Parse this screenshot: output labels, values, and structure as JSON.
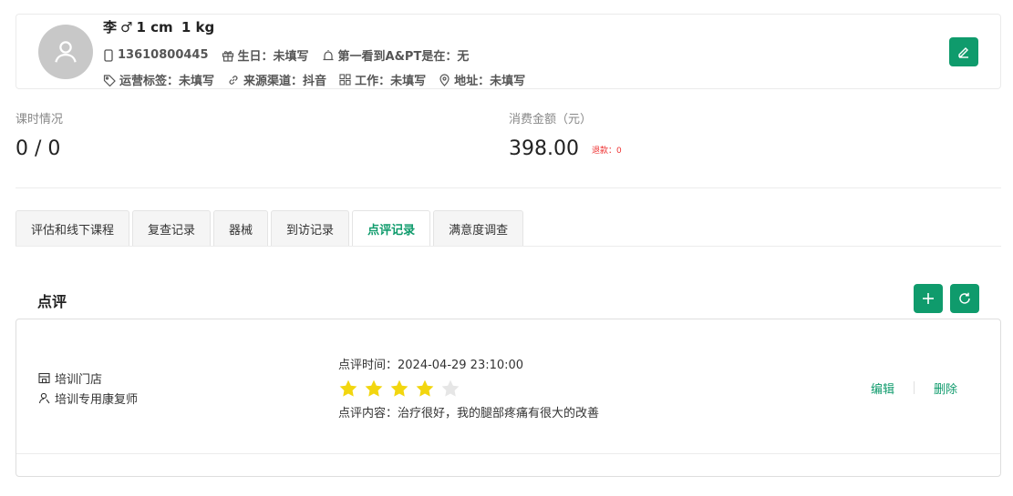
{
  "profile": {
    "name": "李",
    "gender_symbol": "♂",
    "height": "1 cm",
    "weight": "1 kg",
    "phone": "13610800445",
    "birthday_label": "生日：",
    "birthday_value": "未填写",
    "first_seen_label": "第一看到A&PT是在：",
    "first_seen_value": "无",
    "ops_tag_label": "运营标签：",
    "ops_tag_value": "未填写",
    "source_label": "来源渠道：",
    "source_value": "抖音",
    "job_label": "工作：",
    "job_value": "未填写",
    "address_label": "地址：",
    "address_value": "未填写",
    "icons": [
      "avatar-user-icon",
      "phone-icon",
      "gift-icon",
      "alarm-icon",
      "tag-icon",
      "link-icon",
      "grid-icon",
      "location-icon",
      "edit-icon"
    ]
  },
  "stats": {
    "hours_label": "课时情况",
    "hours_value": "0 / 0",
    "spend_label": "消费金额（元）",
    "spend_value": "398.00",
    "refund_text": "退款：0"
  },
  "tabs": [
    {
      "label": "评估和线下课程"
    },
    {
      "label": "复查记录"
    },
    {
      "label": "器械"
    },
    {
      "label": "到访记录"
    },
    {
      "label": "点评记录"
    },
    {
      "label": "满意度调查"
    }
  ],
  "active_tab": "点评记录",
  "section": {
    "title": "点评",
    "icons": [
      "plus-icon",
      "refresh-icon"
    ]
  },
  "reviews": [
    {
      "store": "培训门店",
      "therapist": "培训专用康复师",
      "time_text": "点评时间：2024-04-29 23:10:00",
      "rating": 4,
      "rating_max": 5,
      "content_text": "点评内容：治疗很好，我的腿部疼痛有很大的改善",
      "edit_label": "编辑",
      "delete_label": "删除"
    }
  ],
  "colors": {
    "accent": "#0f9b6c",
    "star_on": "#f2d60f",
    "star_off": "#e6e6e6",
    "refund": "#e33333"
  }
}
